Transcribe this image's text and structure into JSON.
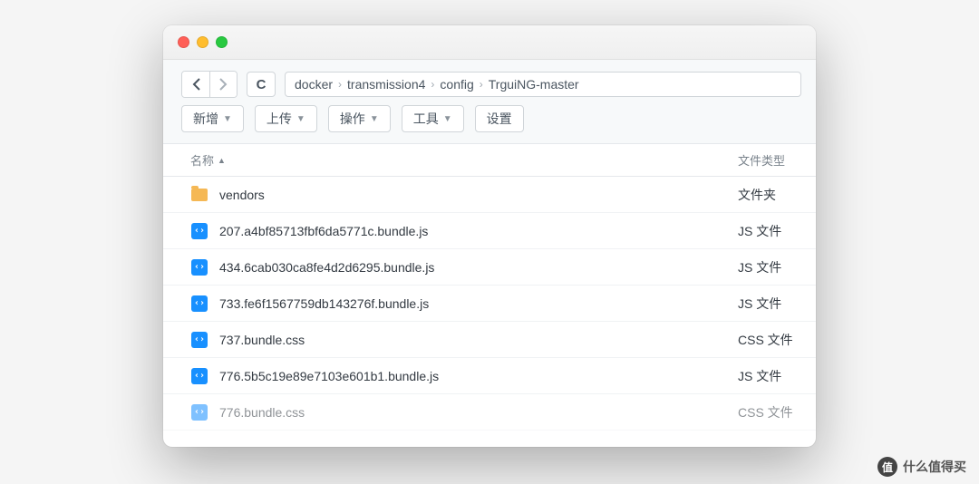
{
  "breadcrumb": [
    "docker",
    "transmission4",
    "config",
    "TrguiNG-master"
  ],
  "toolbar": {
    "new": "新增",
    "upload": "上传",
    "action": "操作",
    "tool": "工具",
    "settings": "设置"
  },
  "columns": {
    "name": "名称",
    "type": "文件类型"
  },
  "files": [
    {
      "icon": "folder",
      "name": "vendors",
      "type": "文件夹"
    },
    {
      "icon": "code",
      "name": "207.a4bf85713fbf6da5771c.bundle.js",
      "type": "JS 文件"
    },
    {
      "icon": "code",
      "name": "434.6cab030ca8fe4d2d6295.bundle.js",
      "type": "JS 文件"
    },
    {
      "icon": "code",
      "name": "733.fe6f1567759db143276f.bundle.js",
      "type": "JS 文件"
    },
    {
      "icon": "code",
      "name": "737.bundle.css",
      "type": "CSS 文件"
    },
    {
      "icon": "code",
      "name": "776.5b5c19e89e7103e601b1.bundle.js",
      "type": "JS 文件"
    },
    {
      "icon": "code",
      "name": "776.bundle.css",
      "type": "CSS 文件"
    }
  ],
  "watermark": {
    "icon": "值",
    "text": "什么值得买"
  }
}
